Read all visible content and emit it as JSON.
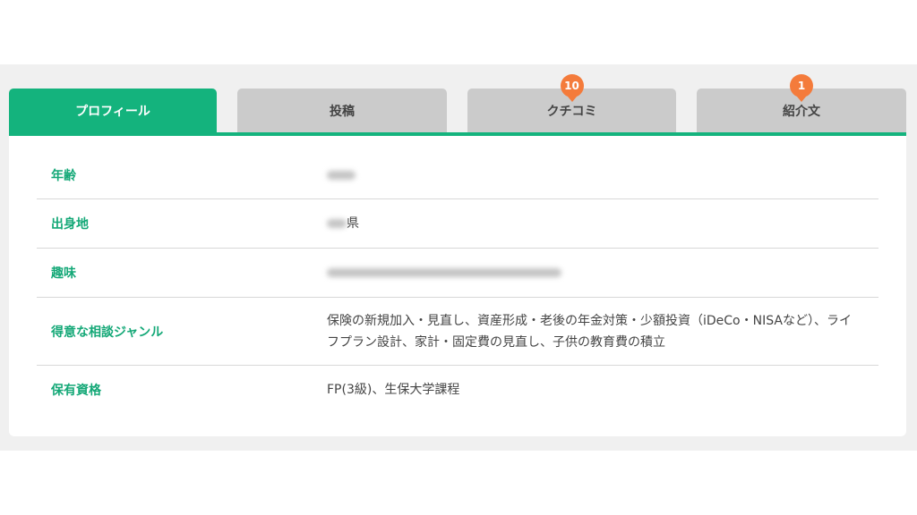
{
  "tabs": [
    {
      "label": "プロフィール",
      "active": true,
      "badge": null
    },
    {
      "label": "投稿",
      "active": false,
      "badge": null
    },
    {
      "label": "クチコミ",
      "active": false,
      "badge": "10"
    },
    {
      "label": "紹介文",
      "active": false,
      "badge": "1"
    }
  ],
  "profile": {
    "age": {
      "label": "年齢",
      "value": ""
    },
    "birthplace": {
      "label": "出身地",
      "value": "県"
    },
    "hobby": {
      "label": "趣味",
      "value": ""
    },
    "specialty": {
      "label": "得意な相談ジャンル",
      "value": "保険の新規加入・見直し、資産形成・老後の年金対策・少額投資（iDeCo・NISAなど）、ライフプラン設計、家計・固定費の見直し、子供の教育費の積立"
    },
    "qualification": {
      "label": "保有資格",
      "value": "FP(3級)、生保大学課程"
    }
  },
  "colors": {
    "accent": "#14b37d",
    "badge": "#f47b3b",
    "tab_inactive": "#cbcbcb"
  }
}
